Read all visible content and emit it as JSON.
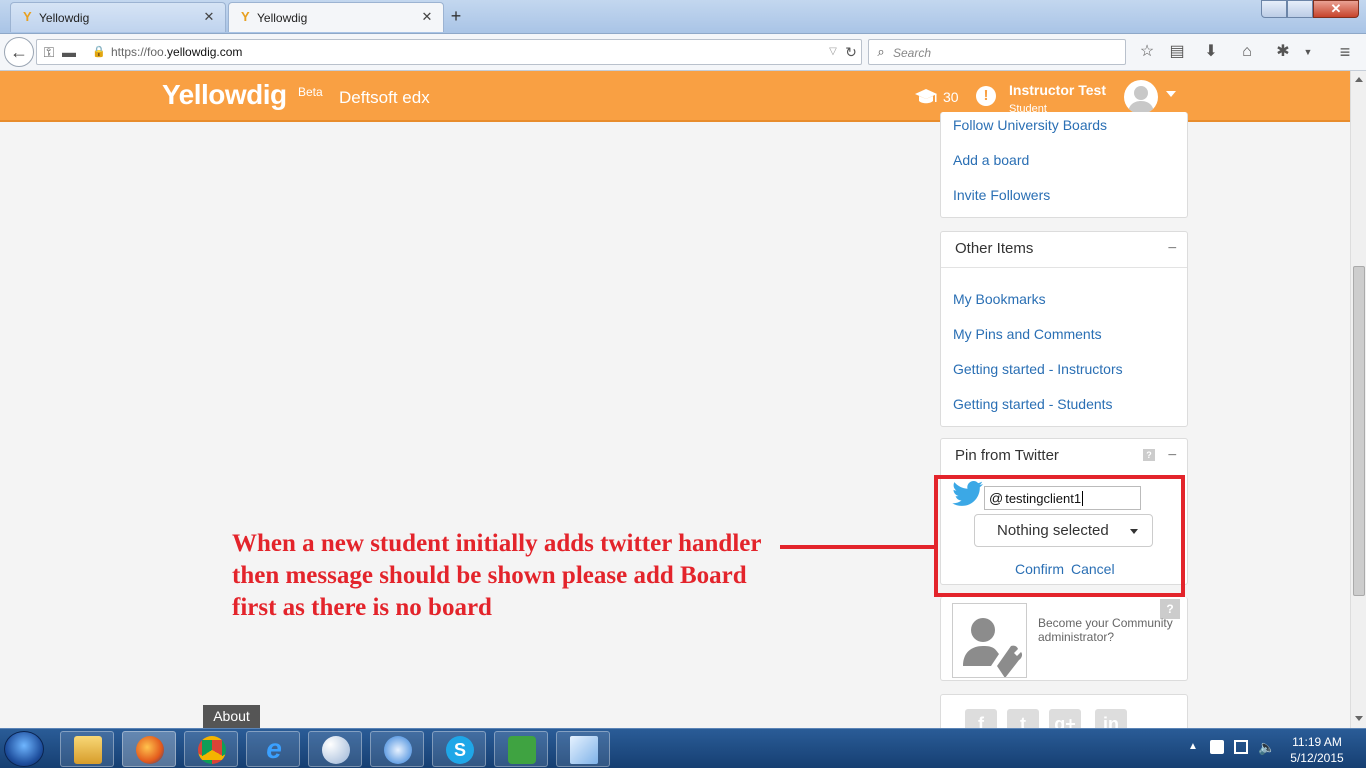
{
  "browser": {
    "tabs": [
      {
        "title": "Yellowdig",
        "active": false
      },
      {
        "title": "Yellowdig",
        "active": true
      }
    ],
    "url_prefix": "https://foo.",
    "url_domain": "yellowdig.com",
    "search_placeholder": "Search"
  },
  "header": {
    "logo": "Yellowdig",
    "beta": "Beta",
    "course": "Deftsoft edx",
    "points": "30",
    "alert_symbol": "!",
    "user_name": "Instructor Test",
    "user_role": "Student"
  },
  "boards_panel": {
    "links": [
      "Follow University Boards",
      "Add a board",
      "Invite Followers"
    ]
  },
  "other_items": {
    "title": "Other Items",
    "toggle": "−",
    "links": [
      "My Bookmarks",
      "My Pins and Comments",
      "Getting started - Instructors",
      "Getting started - Students"
    ]
  },
  "twitter_panel": {
    "title": "Pin from Twitter",
    "help": "?",
    "toggle": "−",
    "at": "@",
    "handle_value": "testingclient1",
    "select_value": "Nothing selected",
    "confirm": "Confirm",
    "cancel": "Cancel"
  },
  "admin_panel": {
    "help": "?",
    "text": "Become your Community administrator?"
  },
  "social": [
    "f",
    "t",
    "g+",
    "in"
  ],
  "annotation": "When a new student initially adds twitter handler then message should be shown please add Board first as there is no board",
  "about": "About",
  "clock": {
    "time": "11:19 AM",
    "date": "5/12/2015"
  },
  "colors": {
    "header": "#f9a043",
    "link": "#2a6fb4",
    "annotation": "#e3242b"
  }
}
